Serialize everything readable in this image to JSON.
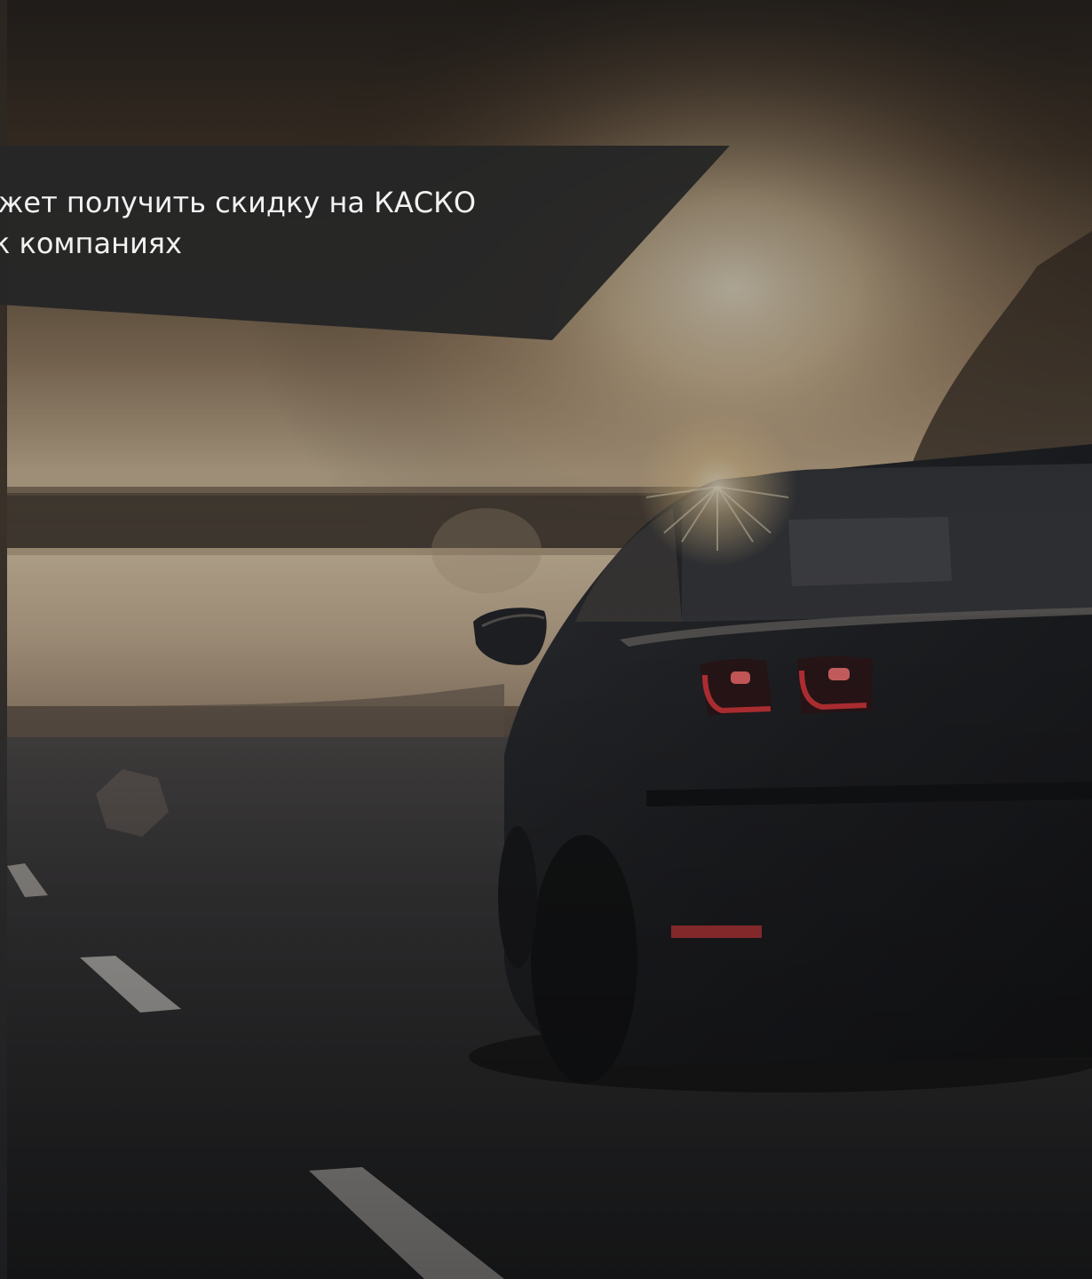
{
  "banner": {
    "line1": "ожет получить скидку на КАСКО",
    "line2": "к компаниях"
  },
  "colors": {
    "banner_bg": "#262626",
    "banner_text": "#f2f2f2",
    "sky_glow": "#e9d2b0",
    "road": "#2c2d30",
    "car_body": "#17191d",
    "taillight": "#e2343a"
  },
  "icons": {
    "hero_photo": "car-on-road-sunset-image"
  }
}
